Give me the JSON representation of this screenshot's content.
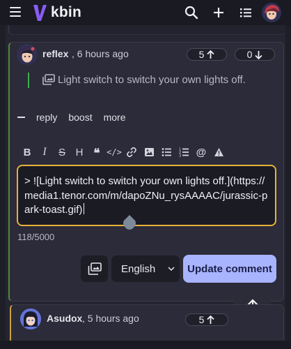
{
  "header": {
    "brand": "kbin",
    "icons": [
      "menu-icon",
      "kbin-logo-icon",
      "search-icon",
      "plus-icon",
      "list-icon",
      "user-avatar"
    ]
  },
  "comment": {
    "author": "reflex",
    "time": ", 6 hours ago",
    "upvotes": "5",
    "downvotes": "0",
    "quote_text": "Light switch to switch your own lights off.",
    "actions": {
      "reply": "reply",
      "boost": "boost",
      "more": "more"
    }
  },
  "editor": {
    "toolbar": [
      "bold",
      "italic",
      "strikethrough",
      "heading",
      "quote",
      "code",
      "link",
      "image",
      "bulleted-list",
      "numbered-list",
      "mention",
      "warning"
    ],
    "text": "> ![Light switch to switch your own lights off.](https://media1.tenor.com/m/dapoZNu_rysAAAAC/jurassic-park-toast.gif)",
    "char_count": "118/5000",
    "language": "English",
    "submit_label": "Update comment"
  },
  "next_comment": {
    "author": "Asudox",
    "time": ", 5 hours ago",
    "upvotes": "5"
  },
  "colors": {
    "accent": "#a9b4ff",
    "focus_border": "#e8b23a",
    "thread_line": "#4f8a38",
    "quote_bar": "#3fae4a",
    "logo": "#8a5cf6"
  }
}
